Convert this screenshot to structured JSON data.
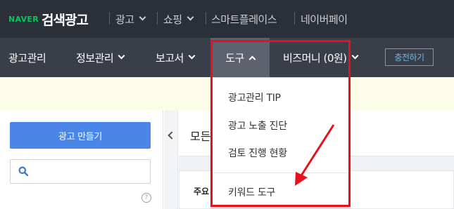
{
  "topbar": {
    "logo": "NAVER",
    "title": "검색광고",
    "links": [
      {
        "label": "광고"
      },
      {
        "label": "쇼핑"
      },
      {
        "label": "스마트플레이스"
      },
      {
        "label": "네이버페이"
      }
    ]
  },
  "mainnav": {
    "items": [
      {
        "label": "광고관리"
      },
      {
        "label": "정보관리"
      },
      {
        "label": "보고서"
      },
      {
        "label": "도구"
      },
      {
        "label": "비즈머니 (0원)"
      }
    ],
    "active": "도구",
    "charge_button": "충전하기"
  },
  "tools_menu": {
    "items": [
      {
        "label": "광고관리 TIP"
      },
      {
        "label": "광고 노출 진단"
      },
      {
        "label": "검토 진행 현황"
      },
      {
        "label": "키워드 도구"
      }
    ]
  },
  "sidebar": {
    "create_ad_button": "광고 만들기",
    "search": {
      "value": "",
      "placeholder": ""
    },
    "help": "?"
  },
  "content": {
    "title": "모든",
    "subtitle": "주요"
  },
  "colors": {
    "topbar_bg": "#2b2f38",
    "mainnav_bg": "#3a3e48",
    "active_tab_bg": "#5d626e",
    "brand_green": "#03c75a",
    "primary_button": "#4a86e8",
    "annotation_red": "#e8101b",
    "banner_bg": "#fcfde8"
  },
  "icons": [
    "chevron-down-icon",
    "chevron-up-icon",
    "search-icon",
    "help-icon",
    "chevron-left-icon",
    "annotation-arrow"
  ]
}
